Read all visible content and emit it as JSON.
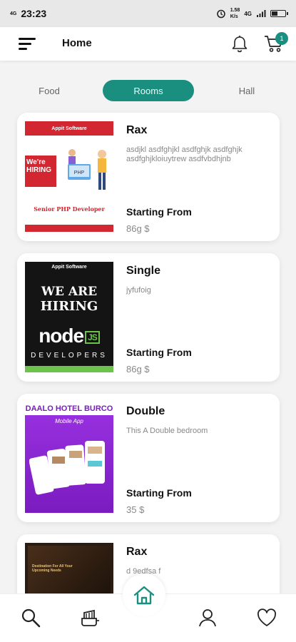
{
  "status_bar": {
    "time": "23:23",
    "sim_label": "4G",
    "network_speed": "1.58\nK/s",
    "network_type": "4G",
    "battery_level": 0.45
  },
  "app_bar": {
    "title": "Home",
    "menu_icon": "menu-icon",
    "bell_icon": "bell-icon",
    "cart_icon": "cart-icon",
    "cart_count": "1"
  },
  "tabs": [
    {
      "label": "Food",
      "active": false
    },
    {
      "label": "Rooms",
      "active": true
    },
    {
      "label": "Hall",
      "active": false
    }
  ],
  "cards": [
    {
      "name": "Rax",
      "description": "asdjkl asdfghjkl asdfghjk asdfghjk asdfghjkloiuytrew asdfvbdhjnb",
      "from_label": "Starting From",
      "price": "86g $",
      "image": {
        "brand": "Appit Software",
        "headline": "We're HIRING",
        "role": "Senior PHP Developer"
      }
    },
    {
      "name": "Single",
      "description": "jyfufoig",
      "from_label": "Starting From",
      "price": "86g $",
      "image": {
        "brand": "Appit Software",
        "line1": "WE ARE",
        "line2": "HIRING",
        "tech": "node",
        "tech_badge": "JS",
        "footer": "DEVELOPERS"
      }
    },
    {
      "name": "Double",
      "description": "This A Double bedroom",
      "from_label": "Starting From",
      "price": "35 $",
      "image": {
        "heading": "DAALO HOTEL BURCO",
        "sub": "Mobile App"
      }
    },
    {
      "name": "Rax",
      "description": "d 9edfsa f",
      "from_label": "",
      "price": "",
      "image": {
        "heading": "Destination For All Your Upcoming Needs"
      }
    }
  ],
  "bottom_nav": {
    "items": [
      "search-icon",
      "food-icon",
      "home-icon",
      "profile-icon",
      "heart-icon"
    ],
    "accent": "#1a8f80"
  },
  "colors": {
    "accent": "#1a8f80",
    "hiring_red": "#d22630",
    "purple": "#8c2ad1"
  }
}
